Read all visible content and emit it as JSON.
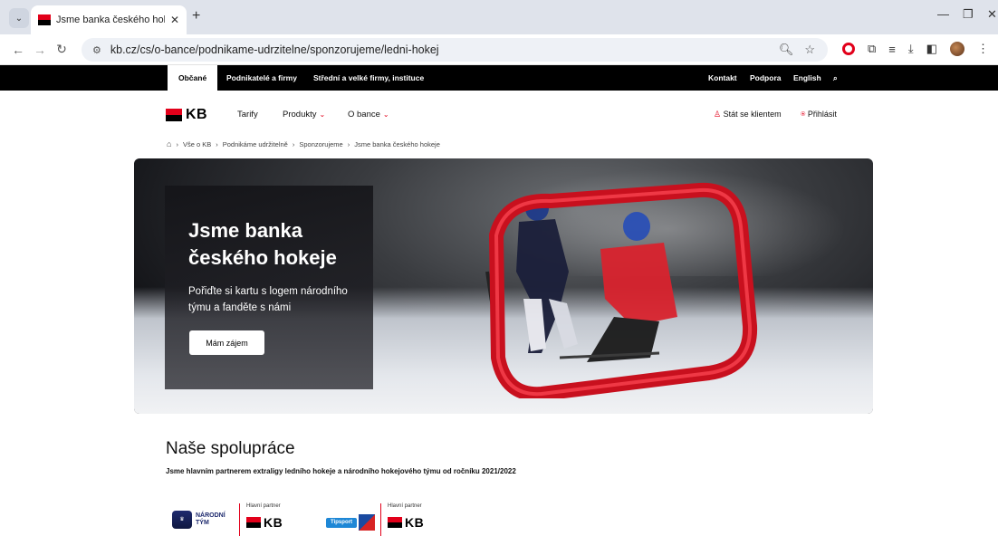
{
  "browser": {
    "tab_title": "Jsme banka českého hokeje | K",
    "url": "kb.cz/cs/o-bance/podnikame-udrzitelne/sponzorujeme/ledni-hokej"
  },
  "topbar": {
    "segments": [
      "Občané",
      "Podnikatelé a firmy",
      "Střední a velké firmy, instituce"
    ],
    "right": [
      "Kontakt",
      "Podpora",
      "English"
    ]
  },
  "header": {
    "logo_text": "KB",
    "nav": [
      "Tarify",
      "Produkty",
      "O bance"
    ],
    "become_client": "Stát se klientem",
    "login": "Přihlásit"
  },
  "breadcrumb": [
    "Vše o KB",
    "Podnikáme udržitelně",
    "Sponzorujeme",
    "Jsme banka českého hokeje"
  ],
  "hero": {
    "title": "Jsme banka českého hokeje",
    "subtitle": "Pořiďte si kartu s logem národního týmu a fanděte s námi",
    "button": "Mám zájem"
  },
  "partnership": {
    "title": "Naše spolupráce",
    "text": "Jsme hlavním partnerem extraligy ledního hokeje a národního hokejového týmu od ročníku 2021/2022",
    "label1": "Hlavní partner",
    "label2": "Hlavní partner",
    "nt_line1": "NÁRODNÍ",
    "nt_line2": "TÝM",
    "tipsport": "Tipsport",
    "kb1": "KB",
    "kb2": "KB"
  },
  "colors": {
    "brand_red": "#e2001a",
    "topbar_bg": "#000000"
  }
}
